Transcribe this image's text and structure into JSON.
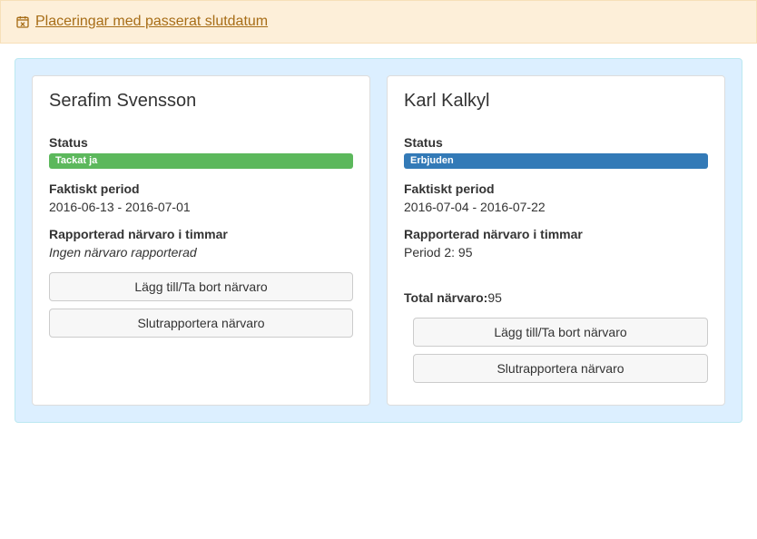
{
  "alert": {
    "link_text": "Placeringar med passerat slutdatum"
  },
  "cards": [
    {
      "name": "Serafim Svensson",
      "status_label": "Status",
      "status_badge": "Tackat ja",
      "status_badge_class": "badge-green",
      "period_label": "Faktiskt period",
      "period_value": "2016-06-13 - 2016-07-01",
      "attendance_label": "Rapporterad närvaro i timmar",
      "attendance_value": "Ingen närvaro rapporterad",
      "attendance_italic": true,
      "has_total": false,
      "btn_add": "Lägg till/Ta bort närvaro",
      "btn_final": "Slutrapportera närvaro"
    },
    {
      "name": "Karl Kalkyl",
      "status_label": "Status",
      "status_badge": "Erbjuden",
      "status_badge_class": "badge-blue",
      "period_label": "Faktiskt period",
      "period_value": "2016-07-04 - 2016-07-22",
      "attendance_label": "Rapporterad närvaro i timmar",
      "attendance_value": "Period 2: 95",
      "attendance_italic": false,
      "has_total": true,
      "total_label": "Total närvaro:",
      "total_value": "95",
      "btn_add": "Lägg till/Ta bort närvaro",
      "btn_final": "Slutrapportera närvaro"
    }
  ]
}
